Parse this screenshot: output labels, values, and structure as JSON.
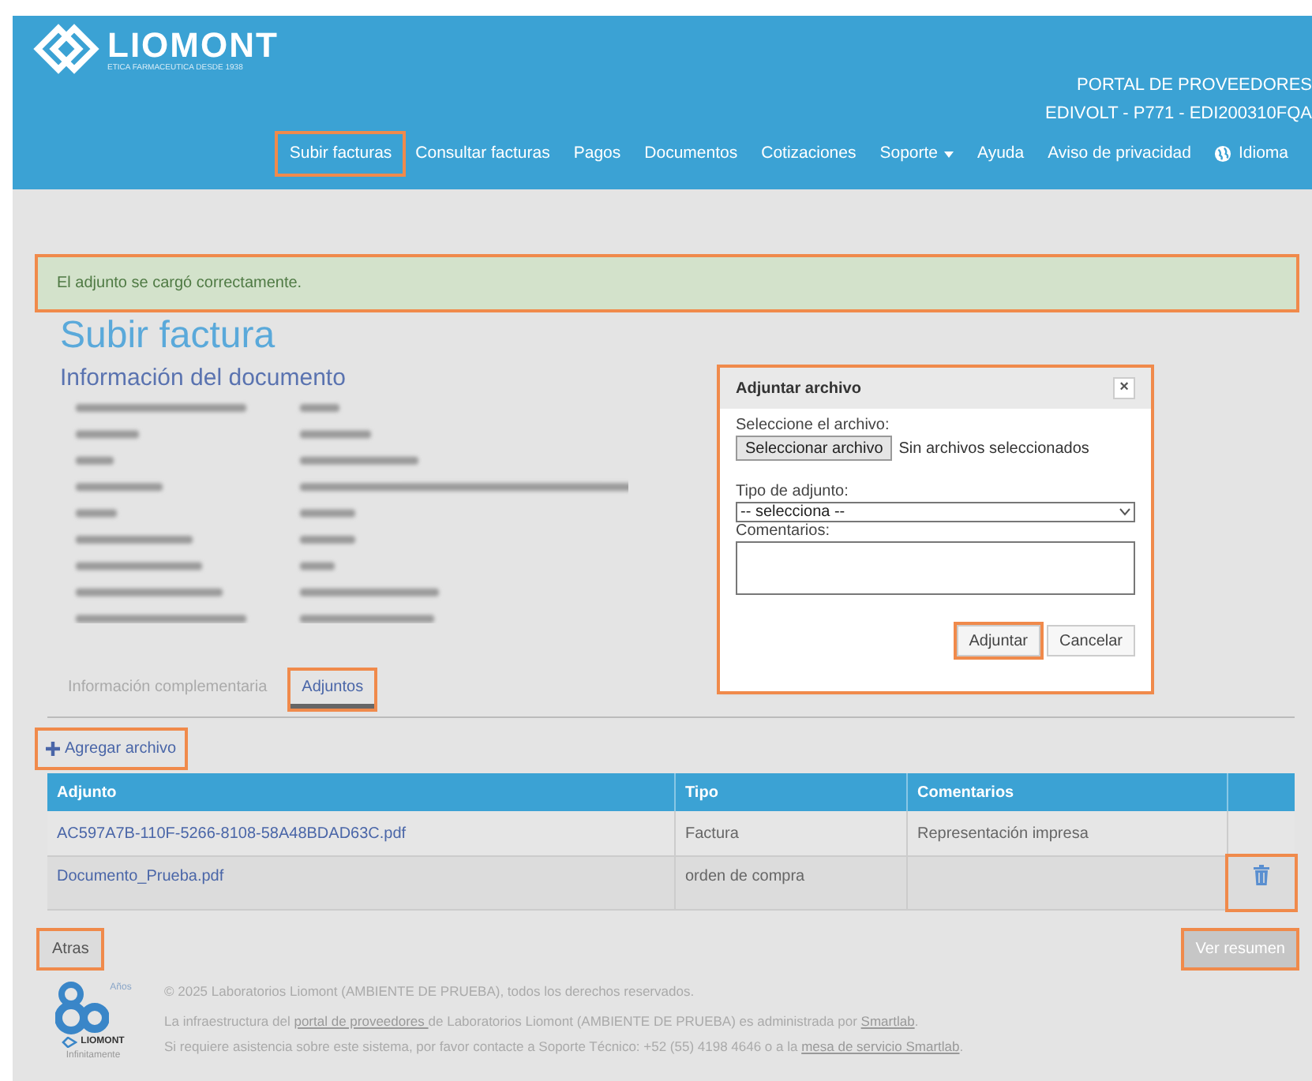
{
  "brand": {
    "name": "LIOMONT",
    "tagline": "ETICA FARMACEUTICA DESDE 1938"
  },
  "portal": {
    "title": "PORTAL DE PROVEEDORES",
    "account": "EDIVOLT - P771 - EDI200310FQA"
  },
  "nav": [
    {
      "label": "Subir facturas",
      "highlighted": true
    },
    {
      "label": "Consultar facturas",
      "highlighted": false
    },
    {
      "label": "Pagos",
      "highlighted": false
    },
    {
      "label": "Documentos",
      "highlighted": false
    },
    {
      "label": "Cotizaciones",
      "highlighted": false
    },
    {
      "label": "Soporte",
      "highlighted": false,
      "kind": "dropdown"
    },
    {
      "label": "Ayuda",
      "highlighted": false
    },
    {
      "label": "Aviso de privacidad",
      "highlighted": false
    },
    {
      "label": "Idioma",
      "highlighted": false,
      "kind": "globe"
    }
  ],
  "alert": {
    "text": "El adjunto se cargó correctamente.",
    "highlighted": true
  },
  "page_title": "Subir factura",
  "section_title": "Información del documento",
  "tabs": [
    {
      "label": "Información complementaria",
      "selected": false,
      "highlighted": false
    },
    {
      "label": "Adjuntos",
      "selected": true,
      "highlighted": true
    }
  ],
  "add_file": {
    "label": "Agregar archivo",
    "highlighted": true
  },
  "table": {
    "columns": [
      "Adjunto",
      "Tipo",
      "Comentarios"
    ],
    "rows": [
      {
        "file": "AC597A7B-110F-5266-8108-58A48BDAD63C.pdf",
        "type": "Factura",
        "comments": "Representación impresa",
        "deletable": false,
        "highlighted": false
      },
      {
        "file": "Documento_Prueba.pdf",
        "type": "orden de compra",
        "comments": "",
        "deletable": true,
        "highlighted": true
      }
    ]
  },
  "back_button": {
    "label": "Atras",
    "highlighted": true
  },
  "summary_button": {
    "label": "Ver resumen",
    "highlighted": true,
    "disabled": true
  },
  "footer": {
    "logo_years": "Años",
    "logo_brand": "LIOMONT",
    "logo_slogan": "Infinitamente",
    "lines": [
      [
        {
          "text": "© 2025 Laboratorios Liomont (AMBIENTE DE PRUEBA), todos los derechos reservados."
        }
      ],
      [
        {
          "text": "La infraestructura del "
        },
        {
          "text": "portal de proveedores ",
          "link": true
        },
        {
          "text": "de Laboratorios Liomont (AMBIENTE DE PRUEBA) es administrada por "
        },
        {
          "text": "Smartlab",
          "link": true
        },
        {
          "text": "."
        }
      ],
      [
        {
          "text": "Si requiere asistencia sobre este sistema, por favor contacte a Soporte Técnico: +52 (55) 4198 4646 o a la "
        },
        {
          "text": "mesa de servicio Smartlab",
          "link": true
        },
        {
          "text": "."
        }
      ]
    ]
  },
  "dialog": {
    "title": "Adjuntar archivo",
    "close": "×",
    "highlighted": true,
    "file_label": "Seleccione el archivo:",
    "file_button": "Seleccionar archivo",
    "file_status": "Sin archivos seleccionados",
    "type_label": "Tipo de adjunto:",
    "type_value": "-- selecciona --",
    "comments_label": "Comentarios:",
    "buttons": [
      {
        "label": "Adjuntar",
        "highlighted": true
      },
      {
        "label": "Cancelar",
        "highlighted": false
      }
    ]
  }
}
